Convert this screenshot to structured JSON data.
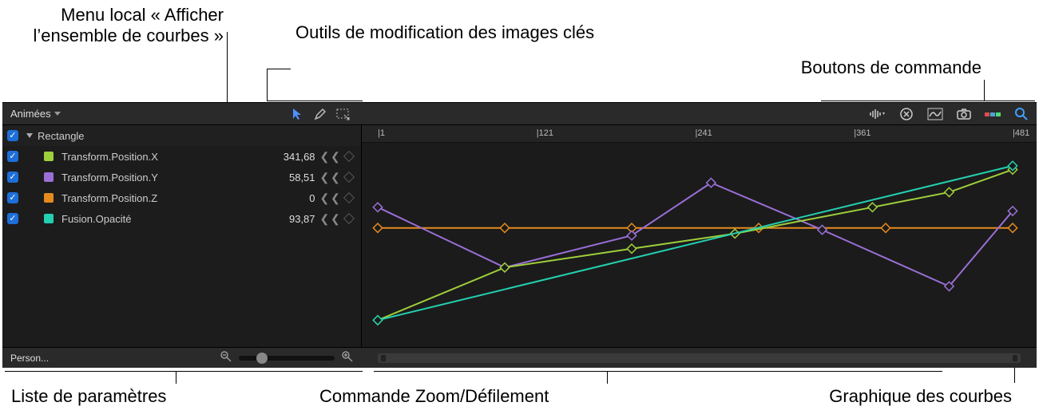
{
  "annotations": {
    "curve_set_menu": "Menu local « Afficher\nl’ensemble de\ncourbes »",
    "keyframe_tools": "Outils de modification\ndes images clés",
    "control_buttons": "Boutons de commande",
    "param_list": "Liste de paramètres",
    "zoom_scroll": "Commande Zoom/Défilement",
    "curve_graph": "Graphique des courbes"
  },
  "popup_label": "Animées",
  "group_name": "Rectangle",
  "params": [
    {
      "name": "Transform.Position.X",
      "value": "341,68",
      "color": "#9fcf3b"
    },
    {
      "name": "Transform.Position.Y",
      "value": "58,51",
      "color": "#9a6fd6"
    },
    {
      "name": "Transform.Position.Z",
      "value": "0",
      "color": "#e58a1f"
    },
    {
      "name": "Fusion.Opacité",
      "value": "93,87",
      "color": "#23d0b0"
    }
  ],
  "ruler_ticks": [
    "1",
    "121",
    "241",
    "361",
    "481"
  ],
  "footer_popup": "Person...",
  "chart_data": {
    "type": "line",
    "xlabel": "",
    "ylabel": "",
    "x_ticks": [
      1,
      121,
      241,
      361,
      481
    ],
    "curves": [
      {
        "name": "Transform.Position.Z",
        "color": "#e58a1f",
        "points": [
          [
            1,
            0.41
          ],
          [
            97,
            0.41
          ],
          [
            193,
            0.41
          ],
          [
            289,
            0.41
          ],
          [
            385,
            0.41
          ],
          [
            481,
            0.41
          ]
        ]
      },
      {
        "name": "Transform.Position.Y",
        "color": "#9a6fd6",
        "points": [
          [
            1,
            0.3
          ],
          [
            97,
            0.62
          ],
          [
            193,
            0.45
          ],
          [
            253,
            0.17
          ],
          [
            337,
            0.42
          ],
          [
            433,
            0.72
          ],
          [
            481,
            0.32
          ]
        ]
      },
      {
        "name": "Transform.Position.X",
        "color": "#9fcf3b",
        "points": [
          [
            1,
            0.9
          ],
          [
            97,
            0.62
          ],
          [
            193,
            0.52
          ],
          [
            271,
            0.44
          ],
          [
            375,
            0.3
          ],
          [
            433,
            0.22
          ],
          [
            481,
            0.1
          ]
        ]
      },
      {
        "name": "Fusion.Opacité",
        "color": "#23d0b0",
        "points": [
          [
            1,
            0.9
          ],
          [
            481,
            0.08
          ]
        ]
      }
    ]
  }
}
